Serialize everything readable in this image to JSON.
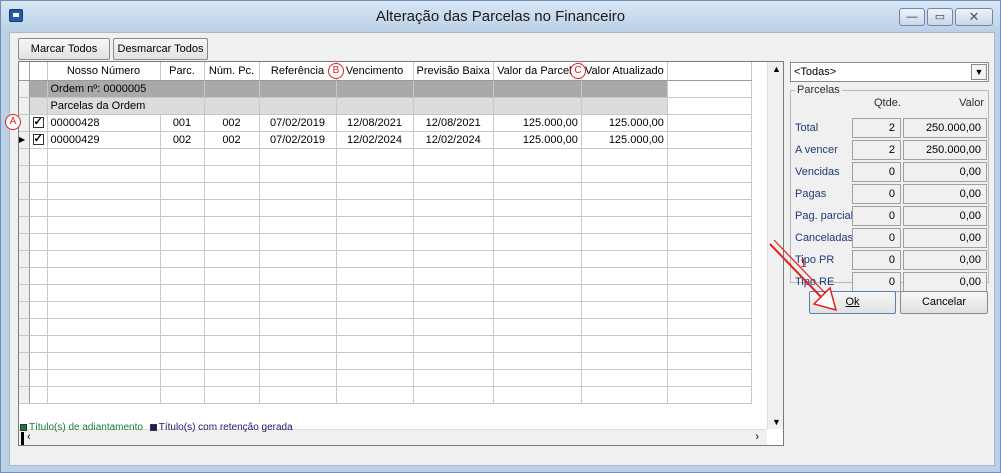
{
  "window": {
    "title": "Alteração das Parcelas no Financeiro",
    "min_glyph": "—",
    "max_glyph": "▭",
    "close_glyph": "✕"
  },
  "toolbar": {
    "marcar_todos": "Marcar Todos",
    "desmarcar_todos": "Desmarcar Todos"
  },
  "grid": {
    "columns": [
      "Nosso Número",
      "Parc.",
      "Núm. Pc.",
      "Referência",
      "Vencimento",
      "Previsão Baixa",
      "Valor da Parcela",
      "Valor Atualizado"
    ],
    "group_ordem": "Ordem nº: 0000005",
    "group_parcelas": "Parcelas da Ordem",
    "rows": [
      {
        "checked": true,
        "nosso_numero": "00000428",
        "parc": "001",
        "num_pc": "002",
        "referencia": "07/02/2019",
        "vencimento": "12/08/2021",
        "previsao_baixa": "12/08/2021",
        "valor_parcela": "125.000,00",
        "valor_atualizado": "125.000,00"
      },
      {
        "checked": true,
        "nosso_numero": "00000429",
        "parc": "002",
        "num_pc": "002",
        "referencia": "07/02/2019",
        "vencimento": "12/02/2024",
        "previsao_baixa": "12/02/2024",
        "valor_parcela": "125.000,00",
        "valor_atualizado": "125.000,00"
      }
    ]
  },
  "legend": {
    "adiantamento": "Título(s) de adiantamento",
    "retencao": "Título(s) com retenção gerada",
    "adiantamento_color": "#1d7a3a",
    "retencao_color": "#1a1a6e"
  },
  "filter": {
    "selected": "<Todas>"
  },
  "parcelas": {
    "title": "Parcelas",
    "qtde_header": "Qtde.",
    "valor_header": "Valor",
    "rows": [
      {
        "label": "Total",
        "qtde": "2",
        "valor": "250.000,00"
      },
      {
        "label": "A vencer",
        "qtde": "2",
        "valor": "250.000,00"
      },
      {
        "label": "Vencidas",
        "qtde": "0",
        "valor": "0,00"
      },
      {
        "label": "Pagas",
        "qtde": "0",
        "valor": "0,00"
      },
      {
        "label": "Pag. parcial",
        "qtde": "0",
        "valor": "0,00"
      },
      {
        "label": "Canceladas",
        "qtde": "0",
        "valor": "0,00"
      },
      {
        "label": "Tipo PR",
        "qtde": "0",
        "valor": "0,00"
      },
      {
        "label": "Tipo RE",
        "qtde": "0",
        "valor": "0,00"
      }
    ]
  },
  "actions": {
    "ok": "Ok",
    "cancelar": "Cancelar"
  },
  "annotations": {
    "a": "A",
    "b": "B",
    "c": "C",
    "one": "1",
    "color": "#dd2222"
  }
}
